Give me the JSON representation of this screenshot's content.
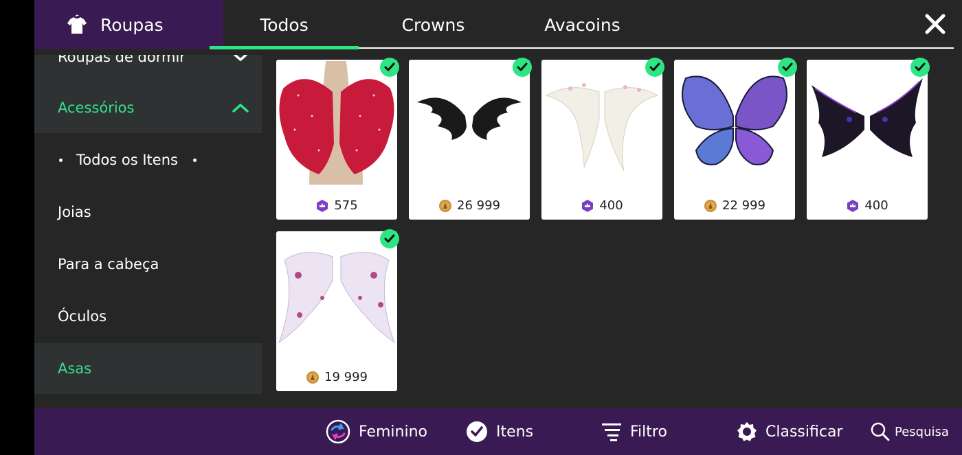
{
  "header": {
    "section_title": "Roupas",
    "section_icon": "shirt-icon",
    "tabs": [
      {
        "label": "Todos",
        "active": true
      },
      {
        "label": "Crowns",
        "active": false
      },
      {
        "label": "Avacoins",
        "active": false
      }
    ],
    "close_icon": "close-icon",
    "accent_color": "#2ee584",
    "brand_color": "#3a1a52"
  },
  "sidebar": {
    "items": [
      {
        "label": "Roupas de dormir",
        "state": "collapsed"
      },
      {
        "label": "Acessórios",
        "state": "expanded",
        "highlight": true
      },
      {
        "label": "Todos os Itens",
        "sub": true
      },
      {
        "label": "Joias"
      },
      {
        "label": "Para a cabeça"
      },
      {
        "label": "Óculos"
      },
      {
        "label": "Asas",
        "selected": true
      }
    ]
  },
  "items": [
    {
      "price": "575",
      "currency": "crowns",
      "owned": true,
      "image": "red-wings"
    },
    {
      "price": "26 999",
      "currency": "avacoins",
      "owned": true,
      "image": "black-wings"
    },
    {
      "price": "400",
      "currency": "crowns",
      "owned": true,
      "image": "white-flower-wings"
    },
    {
      "price": "22 999",
      "currency": "avacoins",
      "owned": true,
      "image": "butterfly-wings"
    },
    {
      "price": "400",
      "currency": "crowns",
      "owned": true,
      "image": "dark-purple-wings"
    },
    {
      "price": "19 999",
      "currency": "avacoins",
      "owned": true,
      "image": "lilac-rose-wings"
    }
  ],
  "bottombar": {
    "gender_label": "Feminino",
    "items_label": "Itens",
    "filter_label": "Filtro",
    "sort_label": "Classificar",
    "search_label": "Pesquisa"
  }
}
